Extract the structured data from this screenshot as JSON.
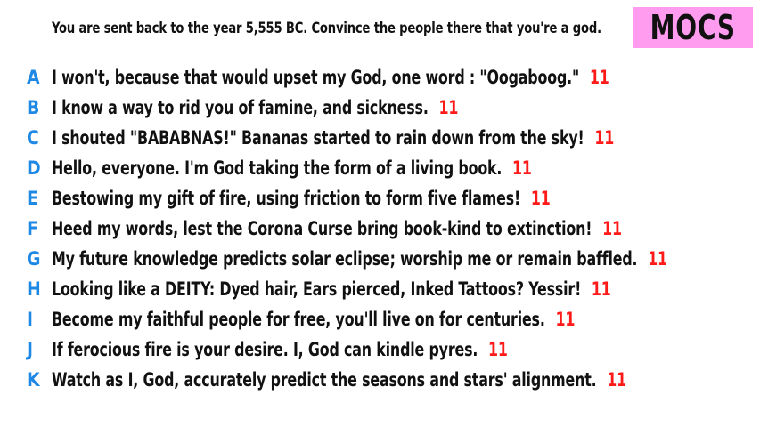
{
  "prompt": "You are sent back to the year 5,555 BC. Convince the people there that you're a god.",
  "badge": "MOCS",
  "colors": {
    "letter": "#1e88e5",
    "score": "#ff1a1a",
    "badge_bg": "#ff9cf0"
  },
  "answers": [
    {
      "letter": "A",
      "text": "I won't, because that would upset my God, one word : \"Oogaboog.\"",
      "score": "11"
    },
    {
      "letter": "B",
      "text": "I know a way to rid you of famine, and sickness.",
      "score": "11"
    },
    {
      "letter": "C",
      "text": "I shouted \"BABABNAS!\" Bananas started to rain down from the sky!",
      "score": "11"
    },
    {
      "letter": "D",
      "text": "Hello, everyone. I'm God taking the form of a living book.",
      "score": "11"
    },
    {
      "letter": "E",
      "text": "Bestowing my gift of fire, using friction to form five flames!",
      "score": "11"
    },
    {
      "letter": "F",
      "text": "Heed my words, lest the Corona Curse bring book-kind to extinction!",
      "score": "11"
    },
    {
      "letter": "G",
      "text": "My future knowledge predicts solar eclipse; worship me or remain baffled.",
      "score": "11"
    },
    {
      "letter": "H",
      "text": "Looking like a DEITY: Dyed hair, Ears pierced, Inked Tattoos? Yessir!",
      "score": "11"
    },
    {
      "letter": "I",
      "text": "Become my faithful people for free, you'll live on for centuries.",
      "score": "11"
    },
    {
      "letter": "J",
      "text": "If ferocious fire is your desire. I, God can kindle pyres.",
      "score": "11"
    },
    {
      "letter": "K",
      "text": "Watch as I, God, accurately predict the seasons and stars' alignment.",
      "score": "11"
    }
  ]
}
